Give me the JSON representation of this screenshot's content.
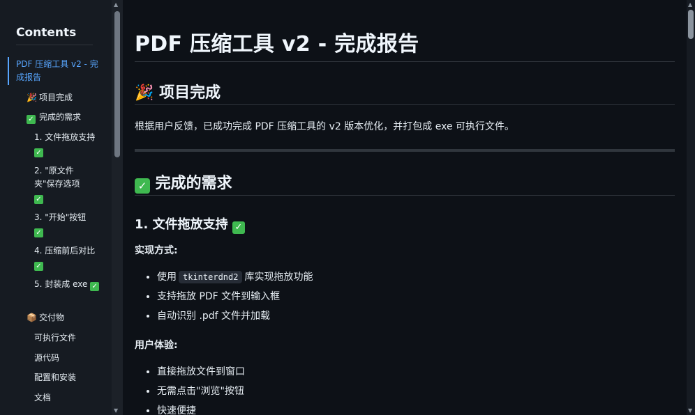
{
  "sidebar": {
    "title": "Contents",
    "items": [
      {
        "label": "PDF 压缩工具 v2 - 完成报告",
        "emoji": ""
      },
      {
        "label": "项目完成",
        "emoji": "🎉"
      },
      {
        "label": "完成的需求",
        "emoji": "✅"
      },
      {
        "label": "1. 文件拖放支持",
        "emoji": ""
      },
      {
        "label": "2. \"原文件夹\"保存选项",
        "emoji": ""
      },
      {
        "label": "3. \"开始\"按钮",
        "emoji": ""
      },
      {
        "label": "4. 压缩前后对比",
        "emoji": ""
      },
      {
        "label": "5. 封装成 exe",
        "emoji": ""
      },
      {
        "label": "交付物",
        "emoji": "📦"
      },
      {
        "label": "可执行文件",
        "emoji": ""
      },
      {
        "label": "源代码",
        "emoji": ""
      },
      {
        "label": "配置和安装",
        "emoji": ""
      },
      {
        "label": "文档",
        "emoji": ""
      }
    ]
  },
  "main": {
    "title": "PDF 压缩工具 v2 - 完成报告",
    "section1": {
      "emoji": "🎉",
      "heading": "项目完成",
      "text": "根据用户反馈，已成功完成 PDF 压缩工具的 v2 版本优化，并打包成 exe 可执行文件。"
    },
    "section2": {
      "heading": "完成的需求",
      "sub1": {
        "heading": "1. 文件拖放支持",
        "impl_label": "实现方式:",
        "impl_items": [
          {
            "before": "使用",
            "code": "tkinterdnd2",
            "after": "库实现拖放功能"
          },
          {
            "text": "支持拖放 PDF 文件到输入框"
          },
          {
            "text": "自动识别 .pdf 文件并加载"
          }
        ],
        "ux_label": "用户体验:",
        "ux_items": [
          "直接拖放文件到窗口",
          "无需点击\"浏览\"按钮",
          "快速便捷"
        ]
      }
    }
  },
  "colors": {
    "background": "#0d1117",
    "sidebar": "#161b22",
    "accent": "#58a6ff",
    "check": "#3fb950"
  }
}
